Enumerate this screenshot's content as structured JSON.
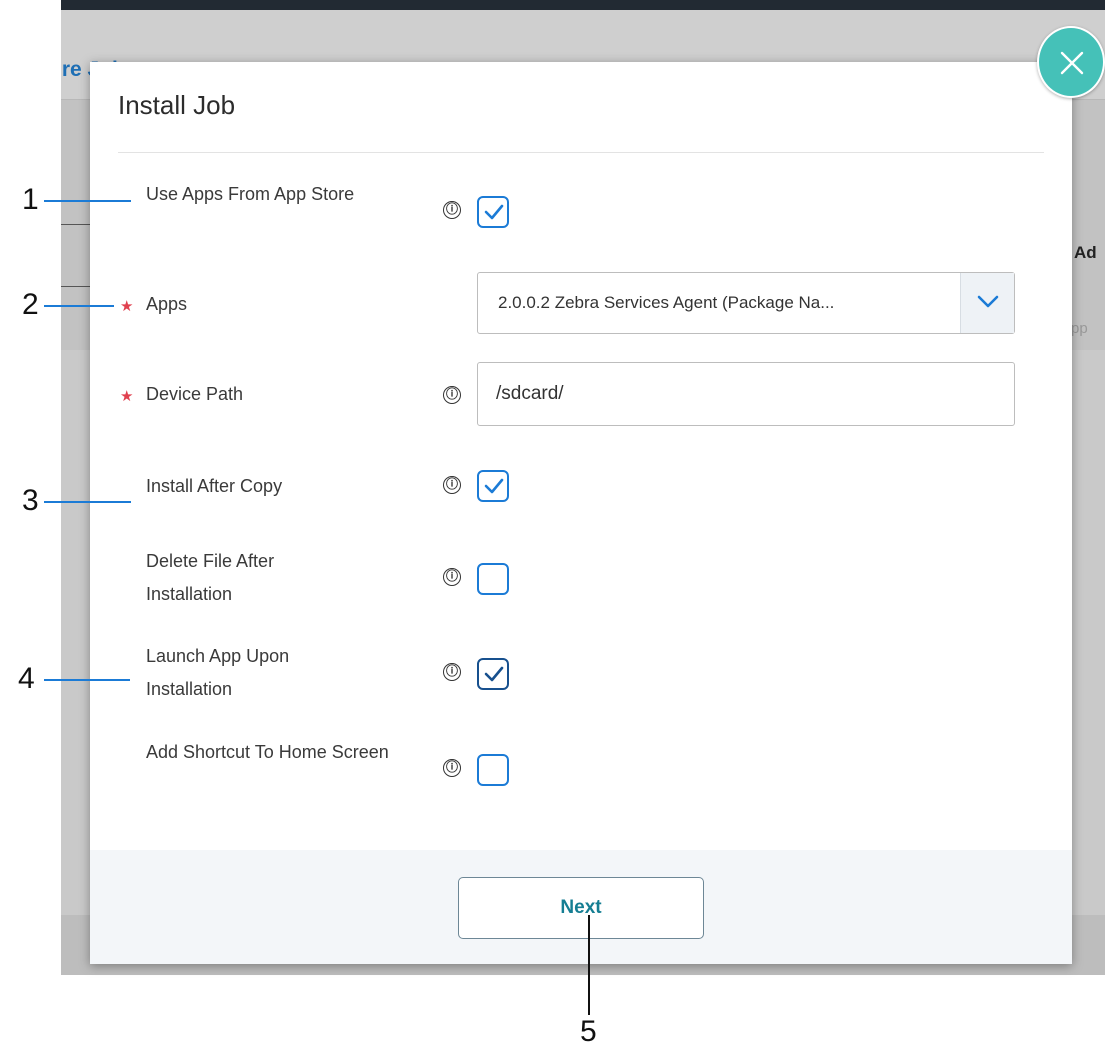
{
  "background": {
    "page_title": "ure Job",
    "right_text_1": "Ad",
    "right_text_2": "pp"
  },
  "modal": {
    "title": "Install Job",
    "fields": {
      "use_apps_from_app_store": {
        "label": "Use Apps From App Store",
        "checked": true
      },
      "apps": {
        "label": "Apps",
        "required": true,
        "selected": "2.0.0.2 Zebra Services Agent (Package Na..."
      },
      "device_path": {
        "label": "Device Path",
        "required": true,
        "value": "/sdcard/"
      },
      "install_after_copy": {
        "label": "Install After Copy",
        "checked": true
      },
      "delete_file_after_installation": {
        "label": "Delete File After Installation",
        "checked": false
      },
      "launch_app_upon_installation": {
        "label": "Launch App Upon Installation",
        "checked": true
      },
      "add_shortcut_to_home_screen": {
        "label": "Add Shortcut To Home Screen",
        "checked": false
      }
    },
    "required_mark": "★",
    "info_icon": "ⓘ",
    "next_label": "Next"
  },
  "callouts": [
    "1",
    "2",
    "3",
    "4",
    "5"
  ],
  "colors": {
    "accent": "#1b7bd6",
    "close_button": "#45c1b8",
    "required": "#e0414f",
    "next_text": "#157e93"
  }
}
